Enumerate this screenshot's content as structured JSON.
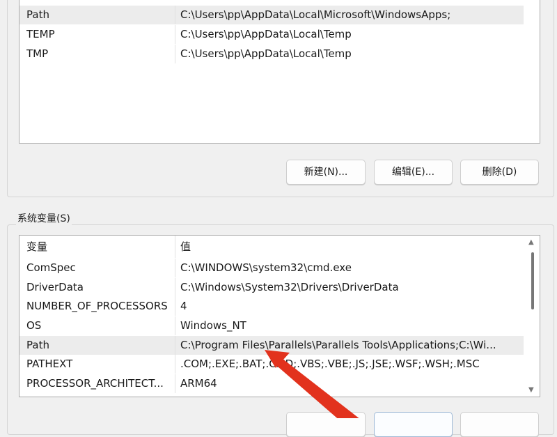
{
  "user_vars": {
    "rows": [
      {
        "name": "Path",
        "value": "C:\\Users\\pp\\AppData\\Local\\Microsoft\\WindowsApps;"
      },
      {
        "name": "TEMP",
        "value": "C:\\Users\\pp\\AppData\\Local\\Temp"
      },
      {
        "name": "TMP",
        "value": "C:\\Users\\pp\\AppData\\Local\\Temp"
      }
    ],
    "buttons": {
      "new": "新建(N)...",
      "edit": "编辑(E)...",
      "delete": "删除(D)"
    }
  },
  "system_vars": {
    "title": "系统变量(S)",
    "columns": {
      "name": "变量",
      "value": "值"
    },
    "rows": [
      {
        "name": "ComSpec",
        "value": "C:\\WINDOWS\\system32\\cmd.exe"
      },
      {
        "name": "DriverData",
        "value": "C:\\Windows\\System32\\Drivers\\DriverData"
      },
      {
        "name": "NUMBER_OF_PROCESSORS",
        "value": "4"
      },
      {
        "name": "OS",
        "value": "Windows_NT"
      },
      {
        "name": "Path",
        "value": "C:\\Program Files\\Parallels\\Parallels Tools\\Applications;C:\\Wi..."
      },
      {
        "name": "PATHEXT",
        "value": ".COM;.EXE;.BAT;.CMD;.VBS;.VBE;.JS;.JSE;.WSF;.WSH;.MSC"
      },
      {
        "name": "PROCESSOR_ARCHITECT...",
        "value": "ARM64"
      }
    ]
  },
  "annotation": {
    "arrow_color": "#e2321d"
  }
}
